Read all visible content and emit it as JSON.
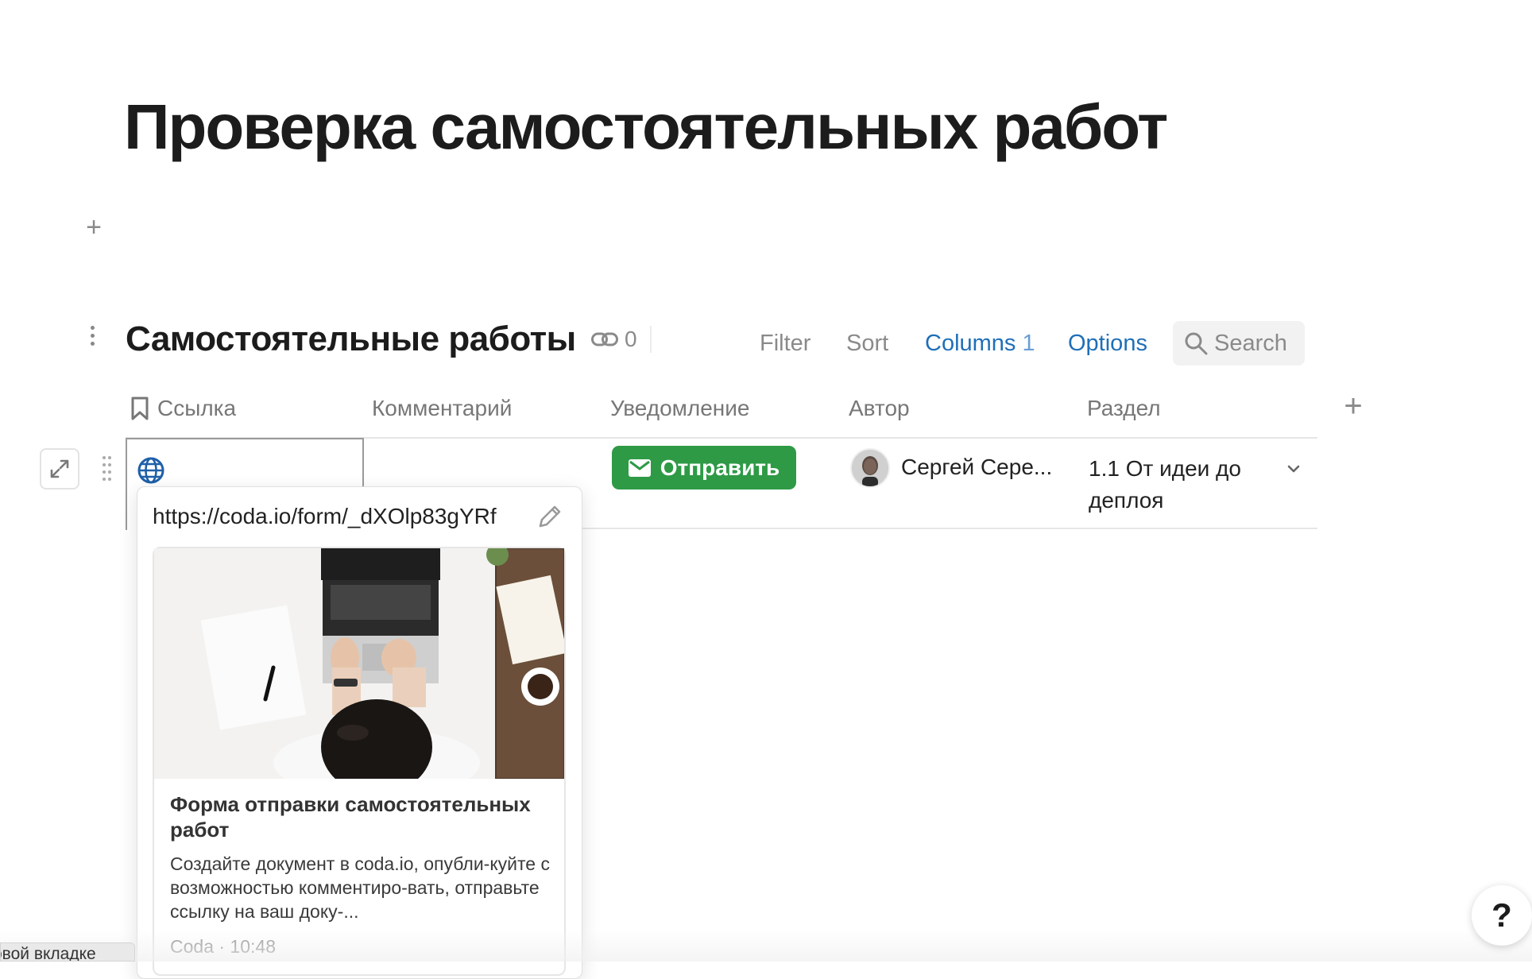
{
  "page": {
    "title": "Проверка самостоятельных работ"
  },
  "table": {
    "title": "Самостоятельные работы",
    "link_count": "0",
    "toolbar": {
      "filter": "Filter",
      "sort": "Sort",
      "columns": "Columns",
      "columns_count": "1",
      "options": "Options",
      "search_placeholder": "Search"
    },
    "columns": [
      "Ссылка",
      "Комментарий",
      "Уведомление",
      "Автор",
      "Раздел"
    ],
    "row": {
      "button_label": "Отправить",
      "author": "Сергей Сере...",
      "section": "1.1 От идеи до деплоя"
    },
    "accent_colors": {
      "blue": "#1f6fb8",
      "green": "#2e9a46"
    }
  },
  "link_popup": {
    "url": "https://coda.io/form/_dXOlp83gYRf",
    "card": {
      "title": "Форма отправки самостоятельных работ",
      "description": "Создайте документ в coda.io, опубли-куйте с возможностью комментиро-вать, отправьте ссылку на ваш доку-...",
      "meta": "Coda · 10:48"
    }
  },
  "status_bar": {
    "text": "овой вкладке"
  },
  "help": {
    "label": "?"
  }
}
